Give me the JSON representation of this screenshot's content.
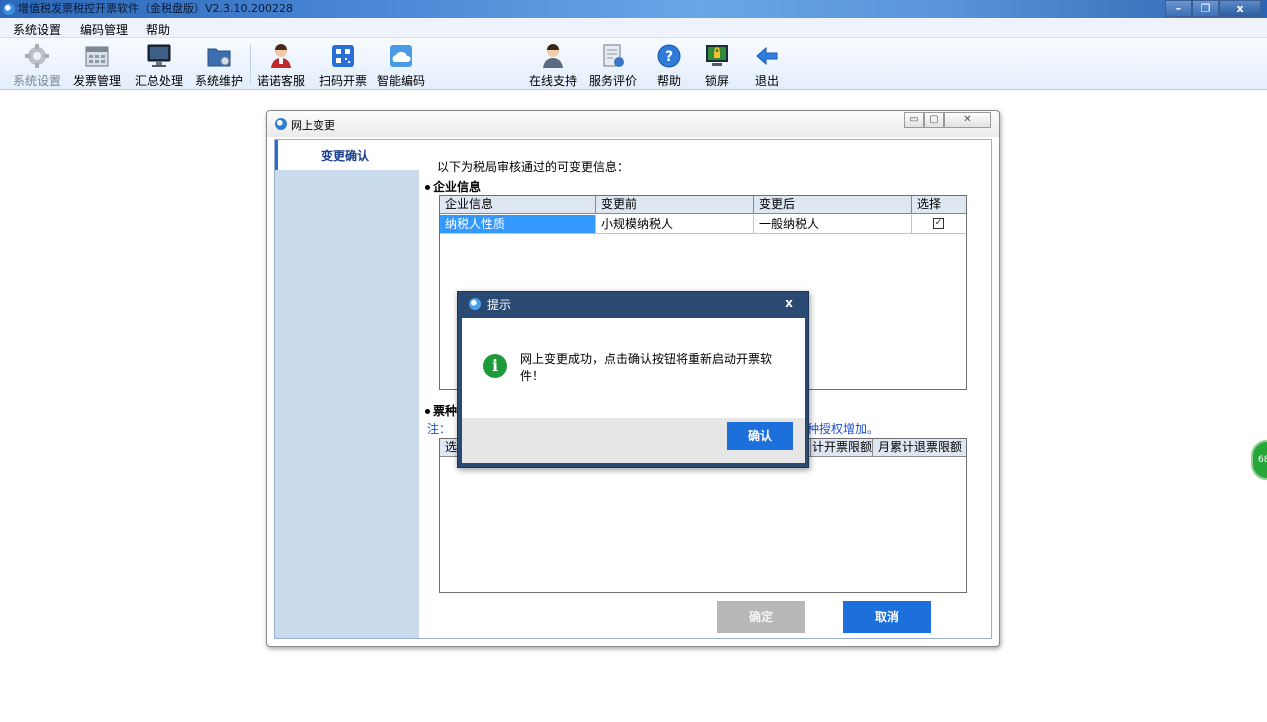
{
  "app": {
    "title": "增值税发票税控开票软件（金税盘版）V2.3.10.200228",
    "window_controls": {
      "minimize": "–",
      "restore": "❐",
      "close": "x"
    }
  },
  "menu": [
    "系统设置",
    "编码管理",
    "帮助"
  ],
  "toolbar": {
    "left": [
      {
        "label": "系统设置",
        "icon": "gear-icon"
      },
      {
        "label": "发票管理",
        "icon": "invoice-icon"
      },
      {
        "label": "汇总处理",
        "icon": "monitor-icon"
      },
      {
        "label": "系统维护",
        "icon": "folder-gear-icon"
      },
      {
        "label": "诺诺客服",
        "icon": "agent-icon"
      },
      {
        "label": "扫码开票",
        "icon": "qrcode-icon"
      },
      {
        "label": "智能编码",
        "icon": "cloud-icon"
      }
    ],
    "right": [
      {
        "label": "在线支持",
        "icon": "support-user-icon"
      },
      {
        "label": "服务评价",
        "icon": "evaluation-icon"
      },
      {
        "label": "帮助",
        "icon": "help-icon"
      },
      {
        "label": "锁屏",
        "icon": "lock-screen-icon"
      },
      {
        "label": "退出",
        "icon": "exit-arrow-icon"
      }
    ]
  },
  "dialog": {
    "title": "网上变更",
    "side_tab": "变更确认",
    "intro": "以下为税局审核通过的可变更信息：",
    "section_enterprise": "企业信息",
    "enterprise_table": {
      "columns": [
        "企业信息",
        "变更前",
        "变更后",
        "选择"
      ],
      "rows": [
        {
          "item": "纳税人性质",
          "before": "小规模纳税人",
          "after": "一般纳税人",
          "checked": "✓"
        }
      ]
    },
    "section_ticket": "票种",
    "note_prefix": "注：",
    "note_suffix": "种授权增加。",
    "ticket_table": {
      "columns": [
        "选",
        "计开票限额",
        "月累计退票限额"
      ]
    },
    "confirm_button": "确定",
    "cancel_button": "取消"
  },
  "modal": {
    "title": "提示",
    "close": "x",
    "message": "网上变更成功，点击确认按钮将重新启动开票软件！",
    "ok_button": "确认"
  },
  "float_badge": "68",
  "colors": {
    "accent": "#1d6fdc",
    "modal_frame": "#2a4a73",
    "selected_row": "#3399ff",
    "side_panel": "#c9dbec"
  }
}
